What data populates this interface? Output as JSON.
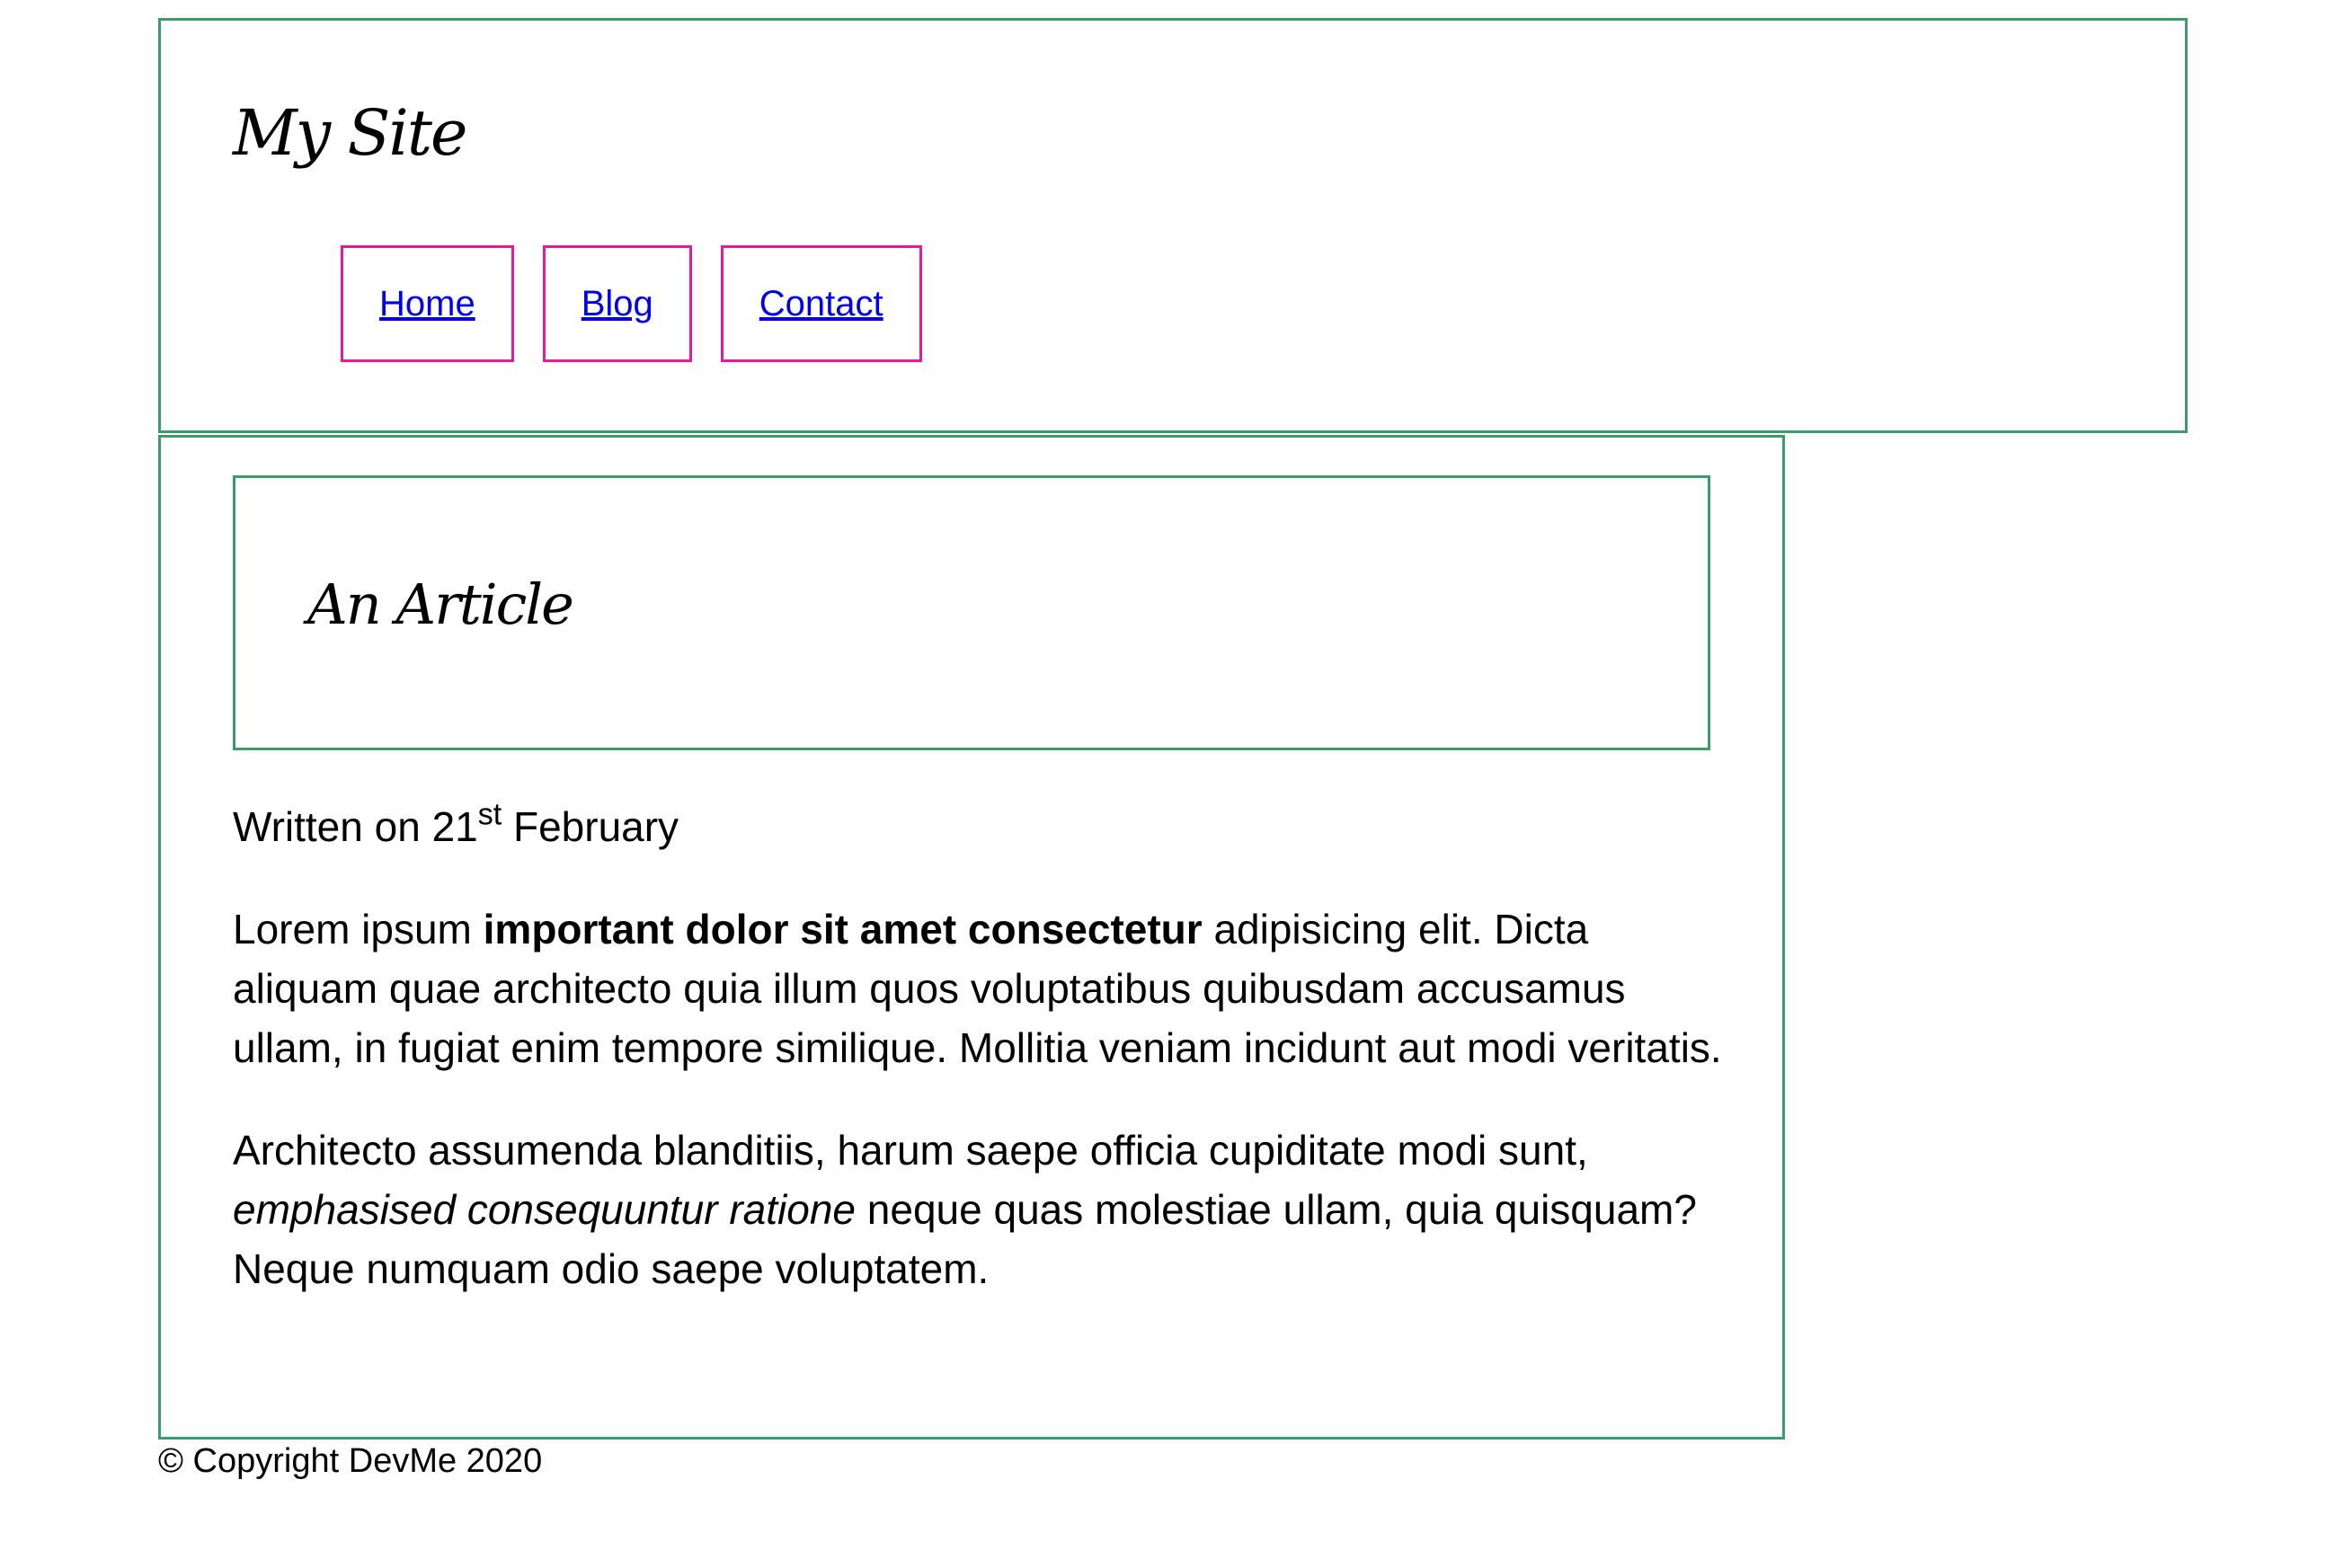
{
  "header": {
    "site_title": "My Site",
    "nav": [
      {
        "label": "Home"
      },
      {
        "label": "Blog"
      },
      {
        "label": "Contact"
      }
    ]
  },
  "article": {
    "title": "An Article",
    "date": {
      "prefix": "Written on 21",
      "ordinal": "st",
      "suffix": " February"
    },
    "paragraph1": {
      "before": "Lorem ipsum ",
      "bold": "important dolor sit amet consectetur",
      "after": " adipisicing elit. Dicta aliquam quae architecto quia illum quos voluptatibus quibusdam accusamus ullam, in fugiat enim tempore similique. Mollitia veniam incidunt aut modi veritatis."
    },
    "paragraph2": {
      "before": "Architecto assumenda blanditiis, harum saepe officia cupiditate modi sunt, ",
      "italic": "emphasised consequuntur ratione",
      "after": " neque quas molestiae ullam, quia quisquam? Neque numquam odio saepe voluptatem."
    }
  },
  "footer": {
    "copyright": "© Copyright DevMe 2020"
  },
  "colors": {
    "section_border": "#3d9a6a",
    "nav_border": "#e81a9b",
    "link": "#0000ee"
  }
}
